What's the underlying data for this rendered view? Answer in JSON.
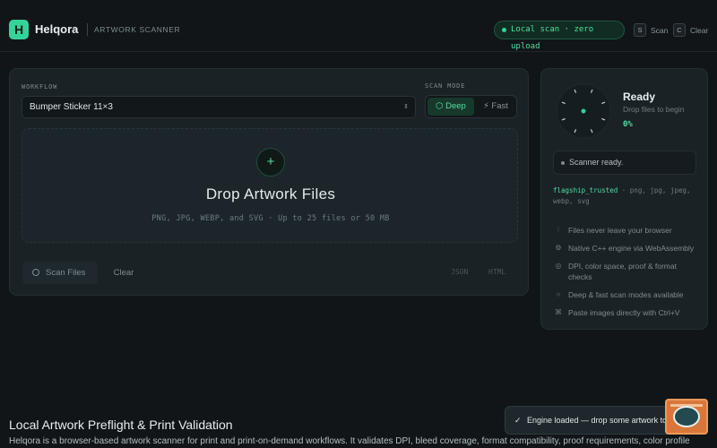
{
  "header": {
    "logo_glyph": "H",
    "brand": "Helqora",
    "subtitle": "ARTWORK SCANNER",
    "status_pill": "Local scan · zero upload",
    "shortcuts": [
      {
        "key": "S",
        "label": "Scan"
      },
      {
        "key": "C",
        "label": "Clear"
      }
    ]
  },
  "workflow": {
    "label": "WORKFLOW",
    "selected": "Bumper Sticker 11×3",
    "scan_mode_label": "SCAN MODE",
    "modes": [
      {
        "label": "⬡ Deep",
        "active": true
      },
      {
        "label": "⚡ Fast",
        "active": false
      }
    ]
  },
  "dropzone": {
    "plus": "+",
    "title": "Drop Artwork Files",
    "subtitle": "PNG, JPG, WEBP, and SVG · Up to 25 files or 50 MB"
  },
  "actions": {
    "scan": "Scan Files",
    "clear": "Clear",
    "export_json": "JSON",
    "export_html": "HTML"
  },
  "side": {
    "ready_title": "Ready",
    "ready_sub": "Drop files to begin",
    "progress_text": "0%",
    "progress": 0,
    "status": "Scanner ready.",
    "trusted_key": "flagship_trusted",
    "trusted_formats": " · png, jpg, jpeg, webp, svg",
    "features": [
      {
        "icon": "lock-icon",
        "glyph": "⦙",
        "text": "Files never leave your browser"
      },
      {
        "icon": "gear-icon",
        "glyph": "⚙",
        "text": "Native C++ engine via WebAssembly"
      },
      {
        "icon": "target-icon",
        "glyph": "◎",
        "text": "DPI, color space, proof & format checks"
      },
      {
        "icon": "circle-icon",
        "glyph": "○",
        "text": "Deep & fast scan modes available"
      },
      {
        "icon": "command-icon",
        "glyph": "⌘",
        "text": "Paste images directly with Ctrl+V"
      }
    ]
  },
  "section": {
    "title": "Local Artwork Preflight & Print Validation",
    "body": "Helqora is a browser-based artwork scanner for print and print-on-demand workflows. It validates DPI, bleed coverage, format compatibility, proof requirements, color profile"
  },
  "toast": {
    "check": "✓",
    "text": "Engine loaded — drop some artwork to scan."
  },
  "colors": {
    "accent": "#35d399",
    "background": "#111518",
    "panel": "#1a2226",
    "help_button": "#d9773b"
  }
}
